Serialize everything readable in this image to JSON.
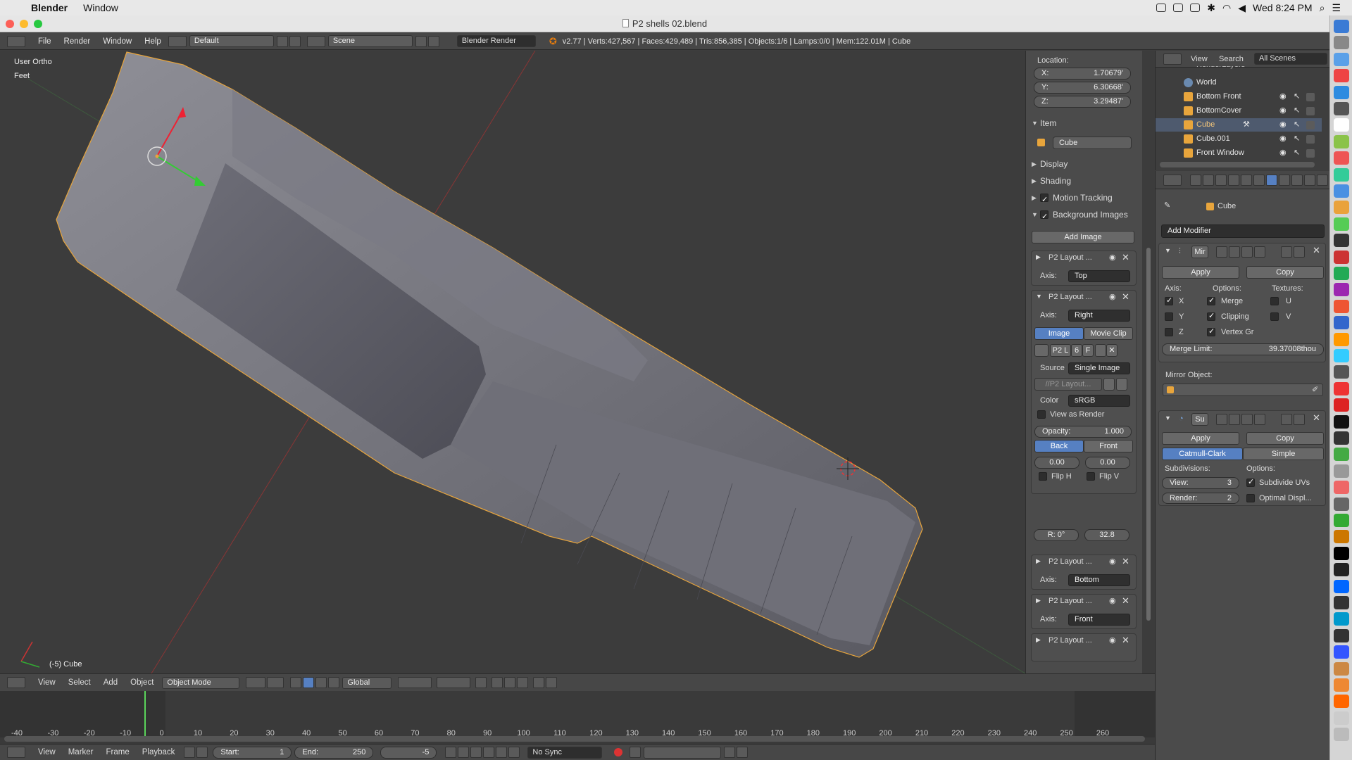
{
  "mac": {
    "app": "Blender",
    "window_menu": "Window",
    "clock": "Wed 8:24 PM"
  },
  "window": {
    "title": "P2 shells 02.blend"
  },
  "info_header": {
    "menus": [
      "File",
      "Render",
      "Window",
      "Help"
    ],
    "layout": "Default",
    "scene": "Scene",
    "engine": "Blender Render",
    "stats": "v2.77 | Verts:427,567 | Faces:429,489 | Tris:856,385 | Objects:1/6 | Lamps:0/0 | Mem:122.01M | Cube"
  },
  "viewport": {
    "view_name": "User Ortho",
    "units": "Feet",
    "object_label": "(-5) Cube"
  },
  "npanel": {
    "location_label": "Location:",
    "x": "X:",
    "x_val": "1.70679'",
    "y": "Y:",
    "y_val": "6.30668'",
    "z": "Z:",
    "z_val": "3.29487'",
    "item": "Item",
    "object_name": "Cube",
    "display": "Display",
    "shading": "Shading",
    "motion_tracking": "Motion Tracking",
    "background_images": "Background Images",
    "add_image": "Add Image",
    "bg1_name": "P2 Layout ...",
    "axis_label": "Axis:",
    "bg1_axis": "Top",
    "bg2_name": "P2 Layout ...",
    "bg2_axis": "Right",
    "image": "Image",
    "movie_clip": "Movie Clip",
    "img_name": "P2 L",
    "img_users": "6",
    "img_f": "F",
    "source_label": "Source",
    "source": "Single Image",
    "path": "//P2 Layout...",
    "color_label": "Color",
    "color": "sRGB",
    "view_as_render": "View as Render",
    "opacity": "Opacity:",
    "opacity_val": "1.000",
    "back": "Back",
    "front": "Front",
    "off_x": "0.00",
    "off_y": "0.00",
    "flip_h": "Flip H",
    "flip_v": "Flip V",
    "rot": "R: 0°",
    "size": "32.8",
    "bg3_name": "P2 Layout ...",
    "bg3_axis": "Bottom",
    "bg4_name": "P2 Layout ...",
    "bg4_axis": "Front",
    "bg5_name": "P2 Layout ..."
  },
  "outliner": {
    "menus": [
      "View",
      "Search"
    ],
    "filter": "All Scenes",
    "rows": [
      "RenderLayers",
      "World",
      "Bottom Front",
      "BottomCover",
      "Cube",
      "Cube.001",
      "Front Window"
    ]
  },
  "props": {
    "context": "Cube",
    "add_modifier": "Add Modifier",
    "mirror": {
      "name": "Mir",
      "apply": "Apply",
      "copy": "Copy",
      "axis": "Axis:",
      "options": "Options:",
      "textures": "Textures:",
      "x": "X",
      "y": "Y",
      "z": "Z",
      "merge": "Merge",
      "clipping": "Clipping",
      "vertex_gr": "Vertex Gr",
      "u": "U",
      "v": "V",
      "merge_limit": "Merge Limit:",
      "merge_limit_val": "39.37008thou",
      "mirror_object": "Mirror Object:"
    },
    "subsurf": {
      "name": "Su",
      "apply": "Apply",
      "copy": "Copy",
      "catmull": "Catmull-Clark",
      "simple": "Simple",
      "subdivisions": "Subdivisions:",
      "options": "Options:",
      "view": "View:",
      "view_val": "3",
      "render": "Render:",
      "render_val": "2",
      "subdivide_uvs": "Subdivide UVs",
      "optimal": "Optimal Displ..."
    }
  },
  "viewport_header": {
    "menus": [
      "View",
      "Select",
      "Add",
      "Object"
    ],
    "mode": "Object Mode",
    "orientation": "Global"
  },
  "timeline": {
    "ticks": [
      "-40",
      "-30",
      "-20",
      "-10",
      "0",
      "10",
      "20",
      "30",
      "40",
      "50",
      "60",
      "70",
      "80",
      "90",
      "100",
      "110",
      "120",
      "130",
      "140",
      "150",
      "160",
      "170",
      "180",
      "190",
      "200",
      "210",
      "220",
      "230",
      "240",
      "250",
      "260"
    ],
    "menus": [
      "View",
      "Marker",
      "Frame",
      "Playback"
    ],
    "start": "Start:",
    "start_val": "1",
    "end": "End:",
    "end_val": "250",
    "current": "-5",
    "sync": "No Sync"
  }
}
